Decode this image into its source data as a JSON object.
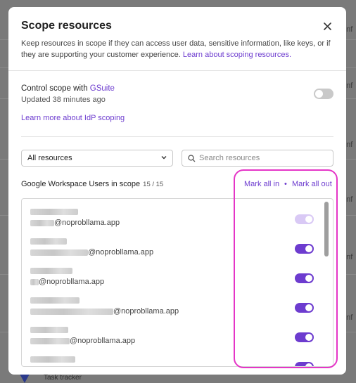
{
  "background": {
    "row_label": "onf",
    "footer_label": "Task tracker"
  },
  "modal": {
    "title": "Scope resources",
    "description": "Keep resources in scope if they can access user data, sensitive information, like keys, or if they are supporting your customer experience.",
    "description_link": "Learn about scoping resources.",
    "control_prefix": "Control scope with ",
    "control_provider": "GSuite",
    "updated": "Updated 38 minutes ago",
    "idp_link": "Learn more about IdP scoping",
    "scope_enabled": false
  },
  "filters": {
    "resource_select": "All resources",
    "search_placeholder": "Search resources"
  },
  "section": {
    "title": "Google Workspace Users in scope",
    "count": "15 / 15",
    "mark_all_in": "Mark all in",
    "separator": "•",
    "mark_all_out": "Mark all out"
  },
  "users": [
    {
      "email_suffix": "@noprobllama.app",
      "in_scope": true,
      "disabled": true
    },
    {
      "email_suffix": "@noprobllama.app",
      "in_scope": true,
      "disabled": false
    },
    {
      "email_suffix": "@noprobllama.app",
      "in_scope": true,
      "disabled": false
    },
    {
      "email_suffix": "@noprobllama.app",
      "in_scope": true,
      "disabled": false
    },
    {
      "email_suffix": "@noprobllama.app",
      "in_scope": true,
      "disabled": false
    },
    {
      "email_suffix": "",
      "in_scope": true,
      "disabled": false
    }
  ],
  "colors": {
    "accent": "#6d3ccf",
    "highlight": "#e535c7"
  }
}
